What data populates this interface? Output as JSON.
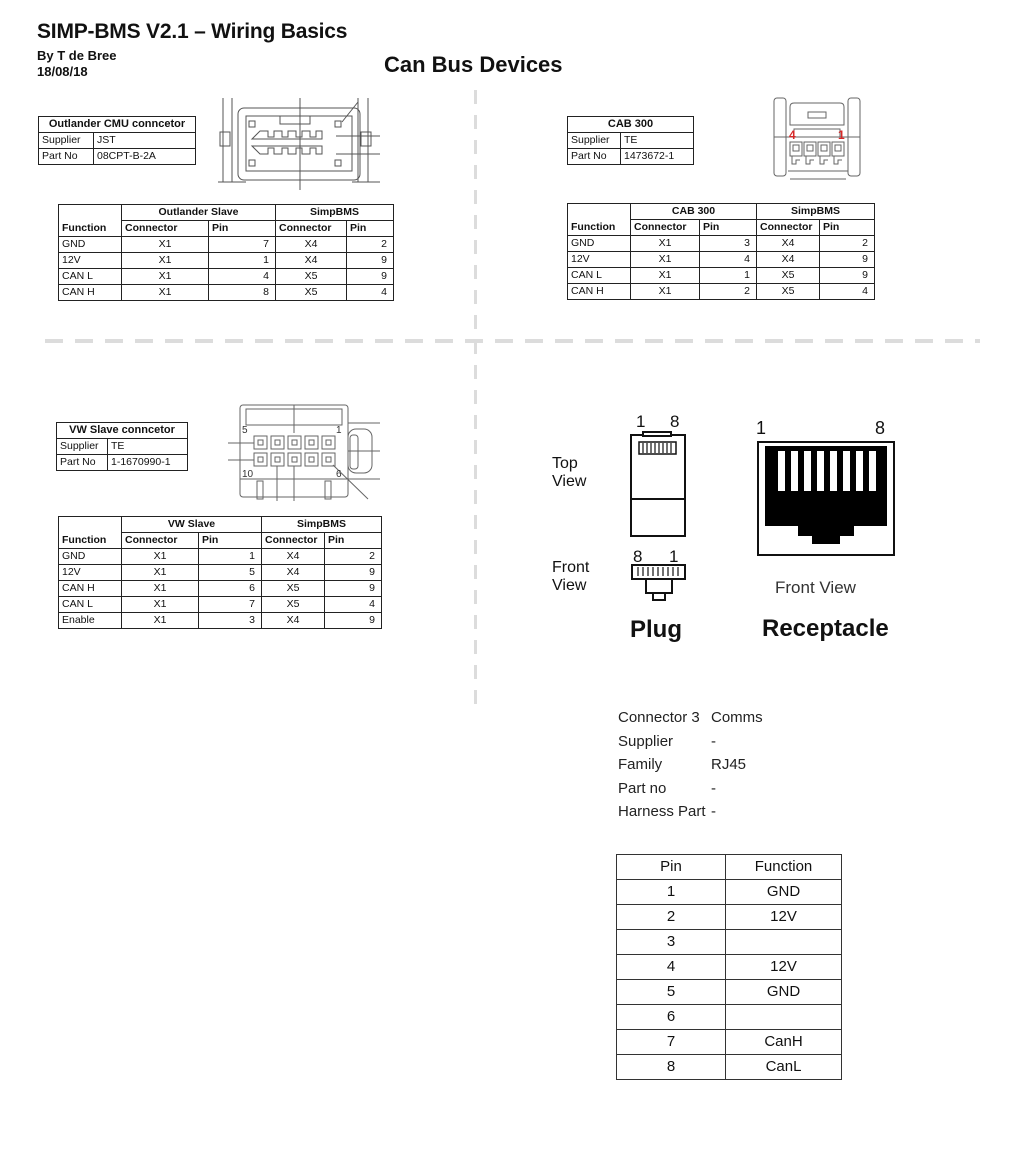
{
  "header": {
    "title": "SIMP-BMS V2.1 – Wiring Basics",
    "author": "By T de Bree",
    "date": "18/08/18",
    "section_title": "Can Bus Devices"
  },
  "outlander": {
    "info": {
      "title": "Outlander CMU conncetor",
      "rows": [
        {
          "label": "Supplier",
          "value": "JST"
        },
        {
          "label": "Part No",
          "value": "08CPT-B-2A"
        }
      ]
    },
    "diagram_icon": "connector-diagram-icon",
    "wiring": {
      "group1": "Outlander Slave",
      "group2": "SimpBMS",
      "columns": [
        "Function",
        "Connector",
        "Pin",
        "Connector",
        "Pin"
      ],
      "rows": [
        [
          "GND",
          "X1",
          "7",
          "X4",
          "2"
        ],
        [
          "12V",
          "X1",
          "1",
          "X4",
          "9"
        ],
        [
          "CAN L",
          "X1",
          "4",
          "X5",
          "9"
        ],
        [
          "CAN H",
          "X1",
          "8",
          "X5",
          "4"
        ]
      ]
    }
  },
  "cab300": {
    "info": {
      "title": "CAB 300",
      "rows": [
        {
          "label": "Supplier",
          "value": "TE"
        },
        {
          "label": "Part No",
          "value": "1473672-1"
        }
      ]
    },
    "diagram": {
      "pin_left": "4",
      "pin_right": "1",
      "accent": "#d62828"
    },
    "wiring": {
      "group1": "CAB 300",
      "group2": "SimpBMS",
      "columns": [
        "Function",
        "Connector",
        "Pin",
        "Connector",
        "Pin"
      ],
      "rows": [
        [
          "GND",
          "X1",
          "3",
          "X4",
          "2"
        ],
        [
          "12V",
          "X1",
          "4",
          "X4",
          "9"
        ],
        [
          "CAN L",
          "X1",
          "1",
          "X5",
          "9"
        ],
        [
          "CAN H",
          "X1",
          "2",
          "X5",
          "4"
        ]
      ]
    }
  },
  "vw": {
    "info": {
      "title": "VW Slave conncetor",
      "rows": [
        {
          "label": "Supplier",
          "value": "TE"
        },
        {
          "label": "Part No",
          "value": "1-1670990-1"
        }
      ]
    },
    "diagram": {
      "pin_tl": "5",
      "pin_tr": "1",
      "pin_bl": "10",
      "pin_br": "6"
    },
    "wiring": {
      "group1": "VW Slave",
      "group2": "SimpBMS",
      "columns": [
        "Function",
        "Connector",
        "Pin",
        "Connector",
        "Pin"
      ],
      "rows": [
        [
          "GND",
          "X1",
          "1",
          "X4",
          "2"
        ],
        [
          "12V",
          "X1",
          "5",
          "X4",
          "9"
        ],
        [
          "CAN H",
          "X1",
          "6",
          "X5",
          "9"
        ],
        [
          "CAN L",
          "X1",
          "7",
          "X5",
          "4"
        ],
        [
          "Enable",
          "X1",
          "3",
          "X4",
          "9"
        ]
      ]
    }
  },
  "rj45": {
    "plug_top_pins": [
      "1",
      "8"
    ],
    "plug_front_pins": [
      "8",
      "1"
    ],
    "top_view_label": [
      "Top",
      "View"
    ],
    "front_view_label": [
      "Front",
      "View"
    ],
    "plug_label": "Plug",
    "receptacle_pins": [
      "1",
      "8"
    ],
    "receptacle_view_label": "Front View",
    "receptacle_label": "Receptacle"
  },
  "connector3": {
    "rows": [
      {
        "label": "Connector 3",
        "value": "Comms"
      },
      {
        "label": "Supplier",
        "value": "-"
      },
      {
        "label": "Family",
        "value": "RJ45"
      },
      {
        "label": "Part no",
        "value": "-"
      },
      {
        "label": "Harness Part",
        "value": "-"
      }
    ],
    "pin_table": {
      "columns": [
        "Pin",
        "Function"
      ],
      "rows": [
        [
          "1",
          "GND"
        ],
        [
          "2",
          "12V"
        ],
        [
          "3",
          ""
        ],
        [
          "4",
          "12V"
        ],
        [
          "5",
          "GND"
        ],
        [
          "6",
          ""
        ],
        [
          "7",
          "CanH"
        ],
        [
          "8",
          "CanL"
        ]
      ]
    }
  }
}
